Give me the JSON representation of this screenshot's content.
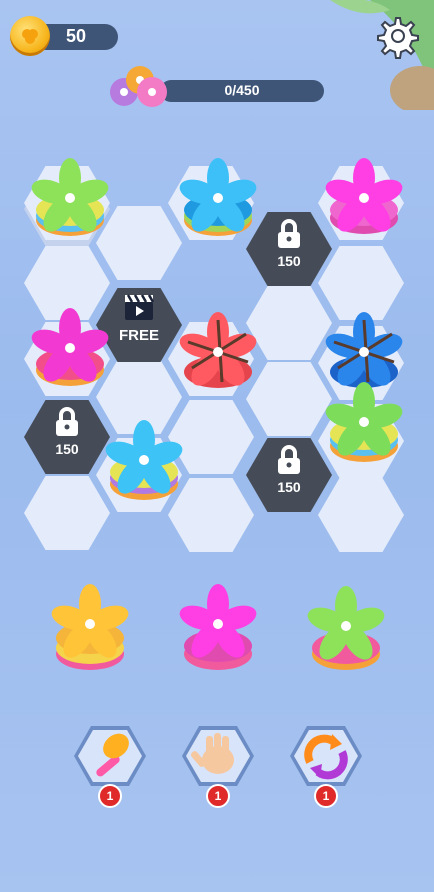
{
  "hud": {
    "coins": "50",
    "progress_text": "0/450",
    "progress_fraction": 0
  },
  "board": {
    "locked_costs": [
      "150",
      "150",
      "150"
    ],
    "free_label": "FREE"
  },
  "boosters": [
    {
      "name": "hammer",
      "count": "1"
    },
    {
      "name": "hand",
      "count": "1"
    },
    {
      "name": "swap",
      "count": "1"
    }
  ],
  "colors": {
    "lock_tile": "#454c57",
    "empty_tile": "#e4ecfb",
    "badge": "#e02a2a"
  }
}
